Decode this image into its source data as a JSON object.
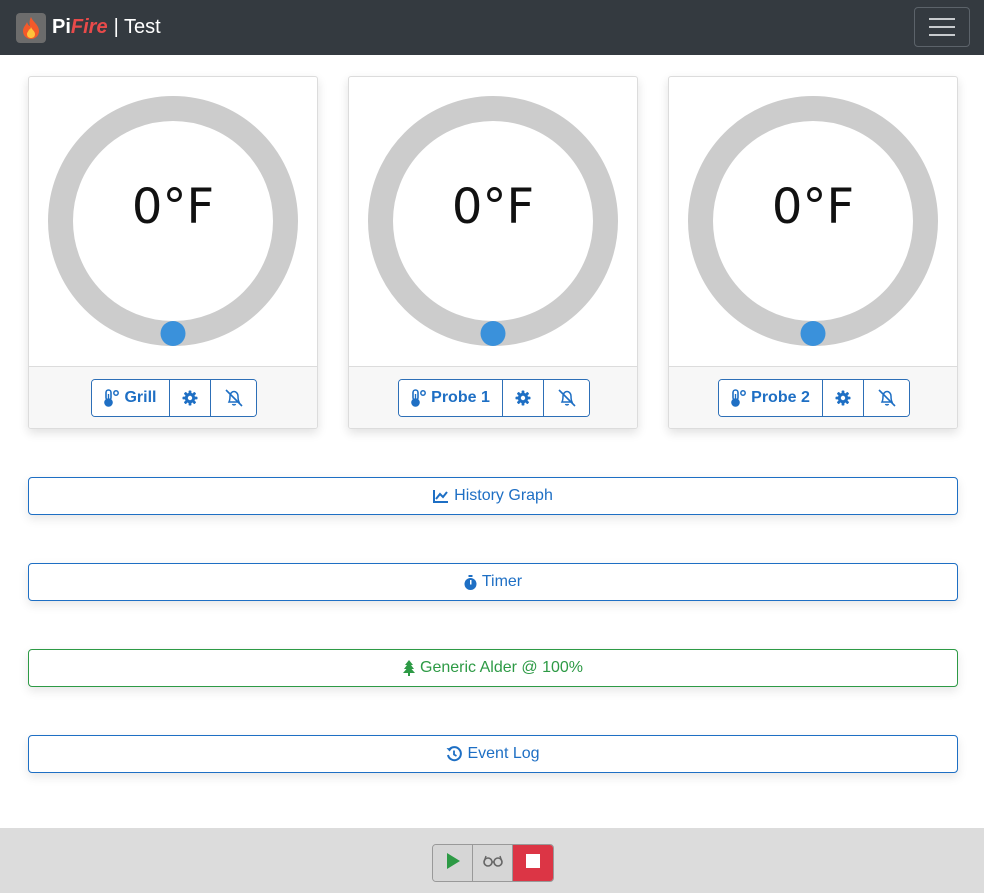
{
  "header": {
    "brand_pi": "Pi",
    "brand_fire": "Fire",
    "brand_rest": "| Test",
    "logo_icon": "flame-icon",
    "menu_icon": "hamburger-menu-icon"
  },
  "probes": [
    {
      "temp": "0°F",
      "label": "Grill",
      "progress": 0
    },
    {
      "temp": "0°F",
      "label": "Probe 1",
      "progress": 0
    },
    {
      "temp": "0°F",
      "label": "Probe 2",
      "progress": 0
    }
  ],
  "buttons": {
    "history": "History Graph",
    "timer": "Timer",
    "pellets": "Generic Alder @ 100%",
    "event_log": "Event Log"
  },
  "controls": {
    "start_icon": "play-icon",
    "monitor_icon": "glasses-icon",
    "stop_icon": "stop-icon"
  },
  "colors": {
    "navbar": "#343a40",
    "primary": "#1e6fc4",
    "success": "#2d9a45",
    "danger": "#dc3545",
    "gauge_track": "#cccccc",
    "gauge_dot": "#3a91db"
  }
}
